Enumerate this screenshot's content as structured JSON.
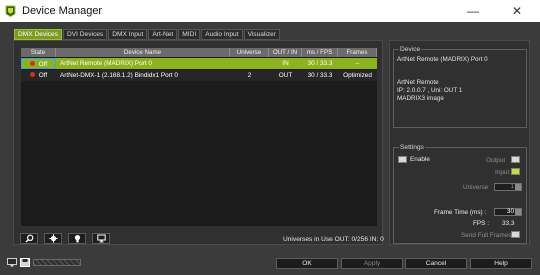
{
  "window": {
    "title": "Device Manager",
    "minimize_glyph": "—",
    "close_glyph": "✕"
  },
  "tabs": [
    {
      "label": "DMX Devices",
      "active": true
    },
    {
      "label": "DVI Devices",
      "active": false
    },
    {
      "label": "DMX Input",
      "active": false
    },
    {
      "label": "Art-Net",
      "active": false
    },
    {
      "label": "MIDI",
      "active": false
    },
    {
      "label": "Audio Input",
      "active": false
    },
    {
      "label": "Visualizer",
      "active": false
    }
  ],
  "table": {
    "columns": [
      "State",
      "Device Name",
      "Universe",
      "OUT / IN",
      "ms / FPS",
      "Frames"
    ],
    "rows": [
      {
        "state": "Off",
        "device_name": "ArtNet Remote (MADRIX) Port 0",
        "universe": "",
        "out_in": "IN",
        "ms_fps": "30 / 33.3",
        "frames": "--",
        "selected": true
      },
      {
        "state": "Off",
        "device_name": "ArtNet-DMX-1 (2.168.1.2) Bindidx1 Port 0",
        "universe": "2",
        "out_in": "OUT",
        "ms_fps": "30 / 33.3",
        "frames": "Optimized",
        "selected": false
      }
    ]
  },
  "toolbar": {
    "buttons": [
      {
        "icon": "search-icon"
      },
      {
        "icon": "gear-icon"
      },
      {
        "icon": "lightbulb-icon"
      },
      {
        "icon": "monitor-icon"
      }
    ],
    "universes_info": "Universes in Use OUT: 0/256  IN: 0"
  },
  "device_panel": {
    "title": "Device",
    "name": "ArtNet Remote (MADRIX) Port 0",
    "info_lines": [
      "ArtNet Remote",
      "IP: 2.0.0.7 , Uni: OUT 1",
      "MADRIX3 image"
    ]
  },
  "settings": {
    "title": "Settings",
    "enable_label": "Enable",
    "enable_checked": false,
    "output_label": "Output",
    "output_checked": false,
    "input_label": "Input",
    "input_checked": true,
    "universe_label": "Universe",
    "universe_value": "1",
    "frame_time_label": "Frame Time (ms) :",
    "frame_time_value": "30",
    "fps_label": "FPS :",
    "fps_value": "33.3",
    "send_full_frames_label": "Send Full Frames",
    "send_full_frames_checked": false
  },
  "buttons": {
    "ok": "OK",
    "apply": "Apply",
    "cancel": "Cancel",
    "help": "Help"
  },
  "colors": {
    "accent_green": "#8cb21c",
    "state_off_red": "#e02a1f",
    "background": "#3b3b3b",
    "table_background": "#1b1b1b"
  }
}
